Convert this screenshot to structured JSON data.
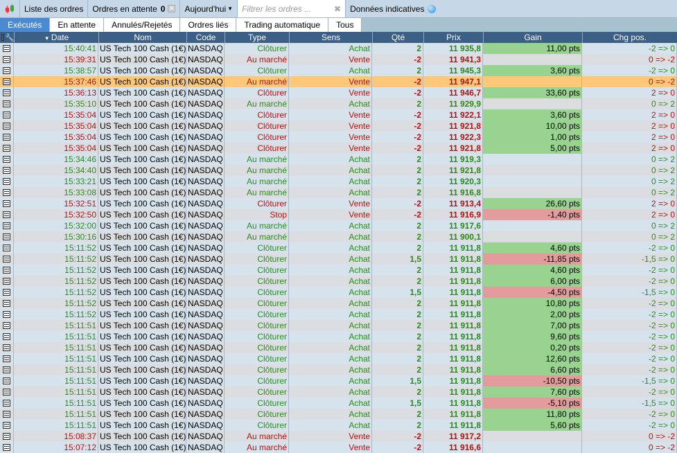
{
  "toolbar": {
    "orders_list": "Liste des ordres",
    "pending_label": "Ordres en attente",
    "pending_count": "0",
    "period": "Aujourd'hui",
    "filter_placeholder": "Filtrer les ordres ...",
    "indicative": "Données indicatives"
  },
  "tabs": [
    "Exécutés",
    "En attente",
    "Annulés/Rejetés",
    "Ordres liés",
    "Trading automatique",
    "Tous"
  ],
  "columns": [
    "Date",
    "Nom",
    "Code",
    "Type",
    "Sens",
    "Qté",
    "Prix",
    "Gain",
    "Chg pos."
  ],
  "rows": [
    [
      "15:40:41",
      "US Tech 100 Cash (1€)",
      "NASDAQ",
      "Clôturer",
      "Achat",
      "2",
      "11 935,8",
      "11,00 pts",
      "-2 => 0"
    ],
    [
      "15:39:31",
      "US Tech 100 Cash (1€)",
      "NASDAQ",
      "Au marché",
      "Vente",
      "-2",
      "11 941,3",
      "",
      "0 => -2"
    ],
    [
      "15:38:57",
      "US Tech 100 Cash (1€)",
      "NASDAQ",
      "Clôturer",
      "Achat",
      "2",
      "11 945,3",
      "3,60 pts",
      "-2 => 0"
    ],
    [
      "15:37:46",
      "US Tech 100 Cash (1€)",
      "NASDAQ",
      "Au marché",
      "Vente",
      "-2",
      "11 947,1",
      "",
      "0 => -2"
    ],
    [
      "15:36:13",
      "US Tech 100 Cash (1€)",
      "NASDAQ",
      "Clôturer",
      "Vente",
      "-2",
      "11 946,7",
      "33,60 pts",
      "2 => 0"
    ],
    [
      "15:35:10",
      "US Tech 100 Cash (1€)",
      "NASDAQ",
      "Au marché",
      "Achat",
      "2",
      "11 929,9",
      "",
      "0 => 2"
    ],
    [
      "15:35:04",
      "US Tech 100 Cash (1€)",
      "NASDAQ",
      "Clôturer",
      "Vente",
      "-2",
      "11 922,1",
      "3,60 pts",
      "2 => 0"
    ],
    [
      "15:35:04",
      "US Tech 100 Cash (1€)",
      "NASDAQ",
      "Clôturer",
      "Vente",
      "-2",
      "11 921,8",
      "10,00 pts",
      "2 => 0"
    ],
    [
      "15:35:04",
      "US Tech 100 Cash (1€)",
      "NASDAQ",
      "Clôturer",
      "Vente",
      "-2",
      "11 922,3",
      "1,00 pts",
      "2 => 0"
    ],
    [
      "15:35:04",
      "US Tech 100 Cash (1€)",
      "NASDAQ",
      "Clôturer",
      "Vente",
      "-2",
      "11 921,8",
      "5,00 pts",
      "2 => 0"
    ],
    [
      "15:34:46",
      "US Tech 100 Cash (1€)",
      "NASDAQ",
      "Au marché",
      "Achat",
      "2",
      "11 919,3",
      "",
      "0 => 2"
    ],
    [
      "15:34:40",
      "US Tech 100 Cash (1€)",
      "NASDAQ",
      "Au marché",
      "Achat",
      "2",
      "11 921,8",
      "",
      "0 => 2"
    ],
    [
      "15:33:21",
      "US Tech 100 Cash (1€)",
      "NASDAQ",
      "Au marché",
      "Achat",
      "2",
      "11 920,3",
      "",
      "0 => 2"
    ],
    [
      "15:33:08",
      "US Tech 100 Cash (1€)",
      "NASDAQ",
      "Au marché",
      "Achat",
      "2",
      "11 916,8",
      "",
      "0 => 2"
    ],
    [
      "15:32:51",
      "US Tech 100 Cash (1€)",
      "NASDAQ",
      "Clôturer",
      "Vente",
      "-2",
      "11 913,4",
      "26,60 pts",
      "2 => 0"
    ],
    [
      "15:32:50",
      "US Tech 100 Cash (1€)",
      "NASDAQ",
      "Stop",
      "Vente",
      "-2",
      "11 916,9",
      "-1,40 pts",
      "2 => 0"
    ],
    [
      "15:32:00",
      "US Tech 100 Cash (1€)",
      "NASDAQ",
      "Au marché",
      "Achat",
      "2",
      "11 917,6",
      "",
      "0 => 2"
    ],
    [
      "15:30:16",
      "US Tech 100 Cash (1€)",
      "NASDAQ",
      "Au marché",
      "Achat",
      "2",
      "11 900,1",
      "",
      "0 => 2"
    ],
    [
      "15:11:52",
      "US Tech 100 Cash (1€)",
      "NASDAQ",
      "Clôturer",
      "Achat",
      "2",
      "11 911,8",
      "4,60 pts",
      "-2 => 0"
    ],
    [
      "15:11:52",
      "US Tech 100 Cash (1€)",
      "NASDAQ",
      "Clôturer",
      "Achat",
      "1,5",
      "11 911,8",
      "-11,85 pts",
      "-1,5 => 0"
    ],
    [
      "15:11:52",
      "US Tech 100 Cash (1€)",
      "NASDAQ",
      "Clôturer",
      "Achat",
      "2",
      "11 911,8",
      "4,60 pts",
      "-2 => 0"
    ],
    [
      "15:11:52",
      "US Tech 100 Cash (1€)",
      "NASDAQ",
      "Clôturer",
      "Achat",
      "2",
      "11 911,8",
      "6,00 pts",
      "-2 => 0"
    ],
    [
      "15:11:52",
      "US Tech 100 Cash (1€)",
      "NASDAQ",
      "Clôturer",
      "Achat",
      "1,5",
      "11 911,8",
      "-4,50 pts",
      "-1,5 => 0"
    ],
    [
      "15:11:52",
      "US Tech 100 Cash (1€)",
      "NASDAQ",
      "Clôturer",
      "Achat",
      "2",
      "11 911,8",
      "10,80 pts",
      "-2 => 0"
    ],
    [
      "15:11:52",
      "US Tech 100 Cash (1€)",
      "NASDAQ",
      "Clôturer",
      "Achat",
      "2",
      "11 911,8",
      "2,00 pts",
      "-2 => 0"
    ],
    [
      "15:11:51",
      "US Tech 100 Cash (1€)",
      "NASDAQ",
      "Clôturer",
      "Achat",
      "2",
      "11 911,8",
      "7,00 pts",
      "-2 => 0"
    ],
    [
      "15:11:51",
      "US Tech 100 Cash (1€)",
      "NASDAQ",
      "Clôturer",
      "Achat",
      "2",
      "11 911,8",
      "9,60 pts",
      "-2 => 0"
    ],
    [
      "15:11:51",
      "US Tech 100 Cash (1€)",
      "NASDAQ",
      "Clôturer",
      "Achat",
      "2",
      "11 911,8",
      "0,20 pts",
      "-2 => 0"
    ],
    [
      "15:11:51",
      "US Tech 100 Cash (1€)",
      "NASDAQ",
      "Clôturer",
      "Achat",
      "2",
      "11 911,8",
      "12,60 pts",
      "-2 => 0"
    ],
    [
      "15:11:51",
      "US Tech 100 Cash (1€)",
      "NASDAQ",
      "Clôturer",
      "Achat",
      "2",
      "11 911,8",
      "6,60 pts",
      "-2 => 0"
    ],
    [
      "15:11:51",
      "US Tech 100 Cash (1€)",
      "NASDAQ",
      "Clôturer",
      "Achat",
      "1,5",
      "11 911,8",
      "-10,50 pts",
      "-1,5 => 0"
    ],
    [
      "15:11:51",
      "US Tech 100 Cash (1€)",
      "NASDAQ",
      "Clôturer",
      "Achat",
      "2",
      "11 911,8",
      "7,60 pts",
      "-2 => 0"
    ],
    [
      "15:11:51",
      "US Tech 100 Cash (1€)",
      "NASDAQ",
      "Clôturer",
      "Achat",
      "1,5",
      "11 911,8",
      "-5,10 pts",
      "-1,5 => 0"
    ],
    [
      "15:11:51",
      "US Tech 100 Cash (1€)",
      "NASDAQ",
      "Clôturer",
      "Achat",
      "2",
      "11 911,8",
      "11,80 pts",
      "-2 => 0"
    ],
    [
      "15:11:51",
      "US Tech 100 Cash (1€)",
      "NASDAQ",
      "Clôturer",
      "Achat",
      "2",
      "11 911,8",
      "5,60 pts",
      "-2 => 0"
    ],
    [
      "15:08:37",
      "US Tech 100 Cash (1€)",
      "NASDAQ",
      "Au marché",
      "Vente",
      "-2",
      "11 917,2",
      "",
      "0 => -2"
    ],
    [
      "15:07:12",
      "US Tech 100 Cash (1€)",
      "NASDAQ",
      "Au marché",
      "Vente",
      "-2",
      "11 916,6",
      "",
      "0 => -2"
    ]
  ],
  "selected_row": 3,
  "colors": {
    "buy": "#2b8a1c",
    "sell": "#b51212",
    "header": "#3c5f86",
    "selected": "#ffc878"
  }
}
